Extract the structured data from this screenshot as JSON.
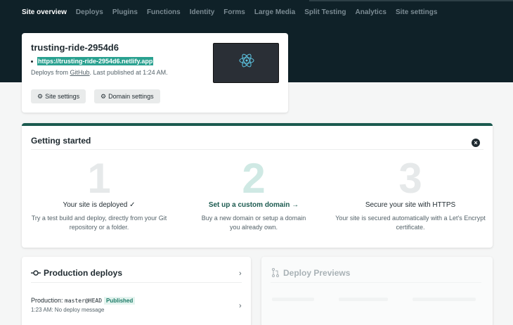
{
  "nav": {
    "items": [
      {
        "label": "Site overview",
        "active": true
      },
      {
        "label": "Deploys"
      },
      {
        "label": "Plugins"
      },
      {
        "label": "Functions"
      },
      {
        "label": "Identity"
      },
      {
        "label": "Forms"
      },
      {
        "label": "Large Media"
      },
      {
        "label": "Split Testing"
      },
      {
        "label": "Analytics"
      },
      {
        "label": "Site settings"
      }
    ]
  },
  "site": {
    "name": "trusting-ride-2954d6",
    "url": "https://trusting-ride-2954d6.netlify.app",
    "deploys_from_prefix": "Deploys from ",
    "provider": "GitHub",
    "published_suffix": ". Last published at 1:24 AM.",
    "site_settings_label": "Site settings",
    "domain_settings_label": "Domain settings",
    "thumbnail_icon": "react-logo-icon"
  },
  "getting_started": {
    "title": "Getting started",
    "steps": [
      {
        "number": "1",
        "title": "Your site is deployed ✓",
        "description": "Try a test build and deploy, directly from your Git repository or a folder."
      },
      {
        "number": "2",
        "title": "Set up a custom domain →",
        "description": "Buy a new domain or setup a domain you already own."
      },
      {
        "number": "3",
        "title": "Secure your site with HTTPS",
        "description": "Your site is secured automatically with a Let's Encrypt certificate."
      }
    ]
  },
  "production": {
    "title": "Production deploys",
    "row_prefix": "Production: ",
    "branch": "master@HEAD",
    "badge": "Published",
    "time_message": "1:23 AM: No deploy message"
  },
  "previews": {
    "title": "Deploy Previews"
  },
  "colors": {
    "header_bg": "#0f2128",
    "accent": "#2aa190",
    "brand_dark": "#1b5a4f"
  }
}
